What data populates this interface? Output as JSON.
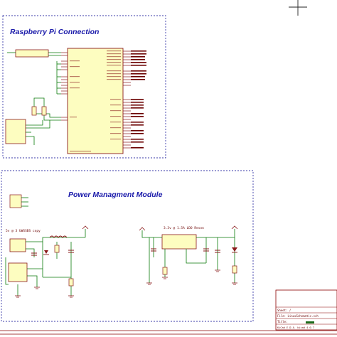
{
  "sections": {
    "rpi": {
      "title": "Raspberry Pi Connection"
    },
    "power": {
      "title": "Power Managment Module",
      "input_label": "5v @ 3 UWSSBS copy",
      "output_label": "3.3v @ 1.5A LDO Reson"
    }
  },
  "title_block": {
    "rows": [
      "Sheet: /",
      "File: LinuxSchematic.sch",
      "Title:"
    ],
    "footer": "KiCad E.D.A.  kicad 4.0.7"
  },
  "colors": {
    "wire": "#0a7a0a",
    "part_outline": "#8a1a1a",
    "part_fill": "#fdfdc0",
    "net_label": "#6b0000",
    "frame": "#8a0000",
    "section_border": "#3a3aa8",
    "section_title": "#1a1aaa"
  },
  "icons": [
    "crosshair-icon"
  ]
}
